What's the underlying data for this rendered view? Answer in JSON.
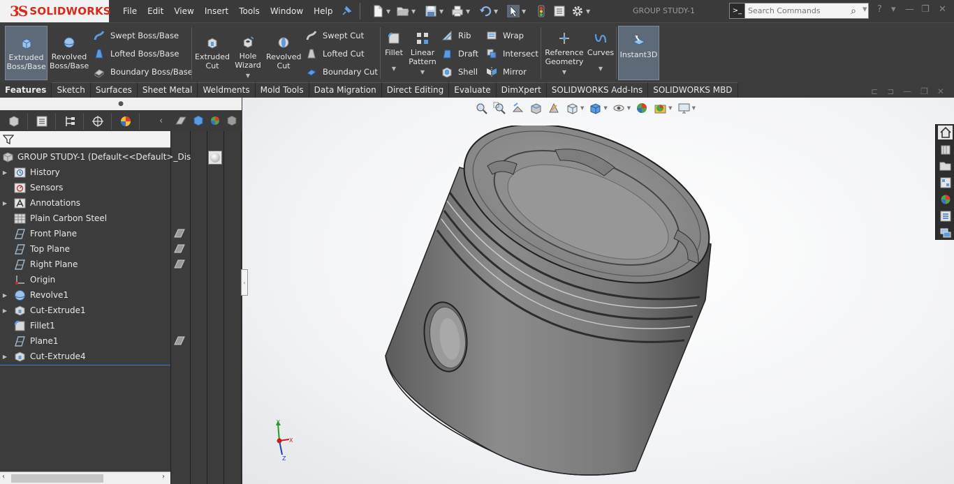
{
  "app": {
    "logo_text": "SOLIDWORKS",
    "document_title": "GROUP STUDY-1",
    "menu": [
      "File",
      "Edit",
      "View",
      "Insert",
      "Tools",
      "Window",
      "Help"
    ],
    "search": {
      "placeholder": "Search Commands"
    }
  },
  "command_manager": {
    "big_buttons": {
      "extruded_boss": "Extruded Boss/Base",
      "revolved_boss": "Revolved Boss/Base",
      "extruded_cut": "Extruded Cut",
      "hole_wizard": "Hole Wizard",
      "revolved_cut": "Revolved Cut",
      "fillet": "Fillet",
      "linear_pattern": "Linear Pattern",
      "reference_geometry": "Reference Geometry",
      "curves": "Curves",
      "instant3d": "Instant3D"
    },
    "small_buttons": {
      "swept_boss": "Swept Boss/Base",
      "lofted_boss": "Lofted Boss/Base",
      "boundary_boss": "Boundary Boss/Base",
      "swept_cut": "Swept Cut",
      "lofted_cut": "Lofted Cut",
      "boundary_cut": "Boundary Cut",
      "rib": "Rib",
      "draft": "Draft",
      "shell": "Shell",
      "wrap": "Wrap",
      "intersect": "Intersect",
      "mirror": "Mirror"
    },
    "tabs": [
      "Features",
      "Sketch",
      "Surfaces",
      "Sheet Metal",
      "Weldments",
      "Mold Tools",
      "Data Migration",
      "Direct Editing",
      "Evaluate",
      "DimXpert",
      "SOLIDWORKS Add-Ins",
      "SOLIDWORKS MBD"
    ],
    "active_tab": "Features"
  },
  "feature_tree": {
    "root": "GROUP STUDY-1  (Default<<Default>_Dis",
    "items": [
      {
        "label": "History",
        "icon": "history-icon",
        "expandable": true
      },
      {
        "label": "Sensors",
        "icon": "sensors-icon",
        "expandable": false
      },
      {
        "label": "Annotations",
        "icon": "annotations-icon",
        "expandable": true
      },
      {
        "label": "Plain Carbon Steel",
        "icon": "material-icon",
        "expandable": false
      },
      {
        "label": "Front Plane",
        "icon": "plane-icon",
        "expandable": false
      },
      {
        "label": "Top Plane",
        "icon": "plane-icon",
        "expandable": false
      },
      {
        "label": "Right Plane",
        "icon": "plane-icon",
        "expandable": false
      },
      {
        "label": "Origin",
        "icon": "origin-icon",
        "expandable": false
      },
      {
        "label": "Revolve1",
        "icon": "revolve-icon",
        "expandable": true
      },
      {
        "label": "Cut-Extrude1",
        "icon": "cut-extrude-icon",
        "expandable": true
      },
      {
        "label": "Fillet1",
        "icon": "fillet-icon",
        "expandable": false
      },
      {
        "label": "Plane1",
        "icon": "plane-icon",
        "expandable": false
      },
      {
        "label": "Cut-Extrude4",
        "icon": "cut-extrude-icon",
        "expandable": true
      }
    ]
  },
  "colors": {
    "accent": "#3b7fd1",
    "brand": "#d62a1c",
    "panel_bg": "#3c3c3c",
    "viewport_bg": "#f4f5f7",
    "part_gray": "#8a8a8a"
  },
  "viewport": {
    "part": "piston",
    "triad_axes": [
      "X",
      "Y",
      "Z"
    ]
  }
}
